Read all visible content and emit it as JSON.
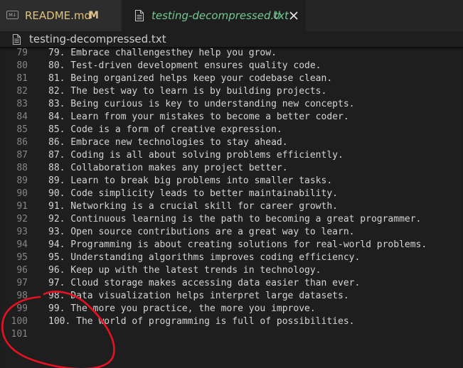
{
  "tabs": [
    {
      "label": "README.md",
      "status": "M",
      "icon_text": "M↓",
      "icon": "markdown-icon",
      "label_color": "#e0c37a"
    },
    {
      "label": "testing-decompressed.txt",
      "status": "U",
      "icon": "text-file-icon",
      "label_color": "#73c991",
      "active": true
    }
  ],
  "breadcrumb": {
    "label": "testing-decompressed.txt",
    "icon": "text-file-icon"
  },
  "editor": {
    "lines": [
      {
        "number": "79",
        "text": "79. Embrace challengesthey help you grow."
      },
      {
        "number": "80",
        "text": "80. Test-driven development ensures quality code."
      },
      {
        "number": "81",
        "text": "81. Being organized helps keep your codebase clean."
      },
      {
        "number": "82",
        "text": "82. The best way to learn is by building projects."
      },
      {
        "number": "83",
        "text": "83. Being curious is key to understanding new concepts."
      },
      {
        "number": "84",
        "text": "84. Learn from your mistakes to become a better coder."
      },
      {
        "number": "85",
        "text": "85. Code is a form of creative expression."
      },
      {
        "number": "86",
        "text": "86. Embrace new technologies to stay ahead."
      },
      {
        "number": "87",
        "text": "87. Coding is all about solving problems efficiently."
      },
      {
        "number": "88",
        "text": "88. Collaboration makes any project better."
      },
      {
        "number": "89",
        "text": "89. Learn to break big problems into smaller tasks."
      },
      {
        "number": "90",
        "text": "90. Code simplicity leads to better maintainability."
      },
      {
        "number": "91",
        "text": "91. Networking is a crucial skill for career growth."
      },
      {
        "number": "92",
        "text": "92. Continuous learning is the path to becoming a great programmer."
      },
      {
        "number": "93",
        "text": "93. Open source contributions are a great way to learn."
      },
      {
        "number": "94",
        "text": "94. Programming is about creating solutions for real-world problems."
      },
      {
        "number": "95",
        "text": "95. Understanding algorithms improves coding efficiency."
      },
      {
        "number": "96",
        "text": "96. Keep up with the latest trends in technology."
      },
      {
        "number": "97",
        "text": "97. Cloud storage makes accessing data easier than ever."
      },
      {
        "number": "98",
        "text": "98. Data visualization helps interpret large datasets."
      },
      {
        "number": "99",
        "text": "99. The more you practice, the more you improve."
      },
      {
        "number": "100",
        "text": "100. The world of programming is full of possibilities."
      },
      {
        "number": "101",
        "text": ""
      }
    ]
  },
  "annotation": {
    "shape": "hand-drawn circle",
    "color": "#e81123"
  },
  "colors": {
    "editor_bg": "#1e1e1e",
    "tabbar_bg": "#252526",
    "inactive_tab_bg": "#2d2d2d",
    "line_number": "#858585",
    "text": "#d4d4d4",
    "untracked_green": "#73c991",
    "modified_yellow": "#e2c08d"
  }
}
